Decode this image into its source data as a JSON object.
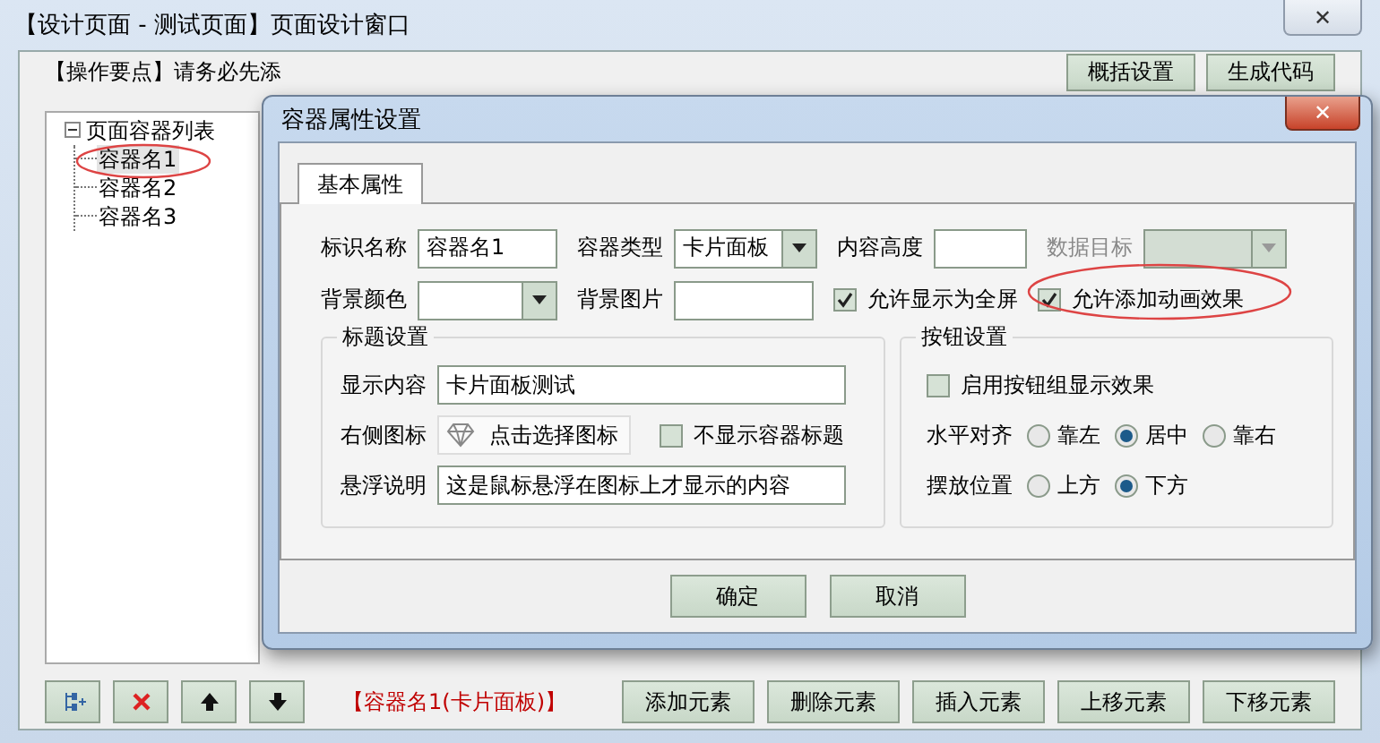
{
  "window": {
    "title": "【设计页面 - 测试页面】页面设计窗口",
    "close": "✕"
  },
  "instruction": "【操作要点】请务必先添",
  "top_buttons": [
    "概括设置",
    "生成代码"
  ],
  "tree": {
    "label": "页面容器列表",
    "expanded": true,
    "children": [
      {
        "label": "容器名1",
        "selected": true
      },
      {
        "label": "容器名2",
        "selected": false
      },
      {
        "label": "容器名3",
        "selected": false
      }
    ]
  },
  "toolbar": [
    {
      "kind": "add-node"
    },
    {
      "kind": "delete"
    },
    {
      "kind": "up"
    },
    {
      "kind": "down"
    }
  ],
  "status": "【容器名1(卡片面板)】",
  "bottom_buttons": [
    "添加元素",
    "删除元素",
    "插入元素",
    "上移元素",
    "下移元素"
  ],
  "dialog": {
    "title": "容器属性设置",
    "close": "✕",
    "tabs": [
      {
        "label": "基本属性",
        "selected": true
      }
    ],
    "rows": [
      [
        {
          "kind": "field",
          "label": "标识名称",
          "value": "容器名1"
        },
        {
          "kind": "dropdown",
          "label": "容器类型",
          "value": "卡片面板",
          "disabled": false
        },
        {
          "kind": "field",
          "label": "内容高度"
        },
        {
          "kind": "dropdown",
          "label": "数据目标",
          "disabled": true
        }
      ],
      [
        {
          "kind": "dropdown",
          "label": "背景颜色",
          "disabled": false
        },
        {
          "kind": "field",
          "label": "背景图片"
        },
        {
          "kind": "checkbox",
          "label": "允许显示为全屏",
          "checked": true
        },
        {
          "kind": "checkbox",
          "label": "允许添加动画效果",
          "checked": true
        }
      ]
    ],
    "title_group": {
      "legend": "标题设置",
      "rows": [
        [
          {
            "kind": "field",
            "label": "显示内容",
            "value": "卡片面板测试"
          }
        ],
        [
          {
            "kind": "iconpicker",
            "label": "右侧图标",
            "value": "点击选择图标"
          },
          {
            "kind": "checkbox",
            "label": "不显示容器标题",
            "checked": false
          }
        ],
        [
          {
            "kind": "field",
            "label": "悬浮说明",
            "value": "这是鼠标悬浮在图标上才显示的内容"
          }
        ]
      ]
    },
    "button_group": {
      "legend": "按钮设置",
      "rows": [
        [
          {
            "kind": "checkbox",
            "label": "启用按钮组显示效果",
            "checked": false
          }
        ],
        [
          {
            "kind": "radio",
            "label": "水平对齐",
            "options": [
              {
                "label": "靠左",
                "selected": false
              },
              {
                "label": "居中",
                "selected": true
              },
              {
                "label": "靠右",
                "selected": false
              }
            ]
          }
        ],
        [
          {
            "kind": "radio",
            "label": "摆放位置",
            "options": [
              {
                "label": "上方",
                "selected": false
              },
              {
                "label": "下方",
                "selected": true
              }
            ]
          }
        ]
      ]
    },
    "buttons": [
      "确定",
      "取消"
    ]
  }
}
